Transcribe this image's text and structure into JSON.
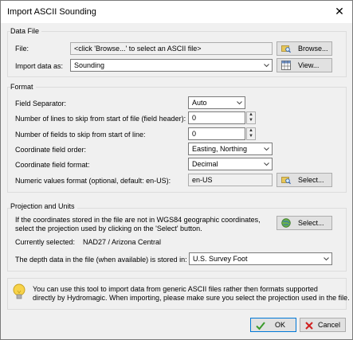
{
  "window": {
    "title": "Import ASCII Sounding",
    "close_glyph": "✕"
  },
  "data_file": {
    "group_label": "Data File",
    "file_label": "File:",
    "file_placeholder": "<click 'Browse...' to select an ASCII file>",
    "browse_label": "Browse...",
    "import_as_label": "Import data as:",
    "import_as_value": "Sounding",
    "view_label": "View..."
  },
  "format": {
    "group_label": "Format",
    "separator_label": "Field Separator:",
    "separator_value": "Auto",
    "skip_lines_label": "Number of lines to skip from start of file (field header):",
    "skip_lines_value": "0",
    "skip_fields_label": "Number of fields to skip from start of line:",
    "skip_fields_value": "0",
    "order_label": "Coordinate field order:",
    "order_value": "Easting, Northing",
    "coord_format_label": "Coordinate field format:",
    "coord_format_value": "Decimal",
    "numeric_label": "Numeric values format (optional, default: en-US):",
    "numeric_value": "en-US",
    "select_label": "Select..."
  },
  "projection": {
    "group_label": "Projection and Units",
    "info_line1": "If the coordinates stored in the file are not in WGS84 geographic coordinates,",
    "info_line2": "select the projection used by clicking on the 'Select' button.",
    "select_label": "Select...",
    "current_label": "Currently selected:",
    "current_value": "NAD27 / Arizona Central",
    "depth_label": "The depth data in the file (when available) is stored in:",
    "depth_value": "U.S. Survey Foot"
  },
  "hint": {
    "line1": "You can use this tool to import data from generic ASCII files rather then formats supported",
    "line2": "directly by Hydromagic. When importing, please make sure you select the projection used in the file."
  },
  "buttons": {
    "ok": "OK",
    "cancel": "Cancel"
  },
  "colors": {
    "ok_check": "#3a9a2a",
    "cancel_x": "#d02020",
    "bulb": "#f7d34a"
  }
}
